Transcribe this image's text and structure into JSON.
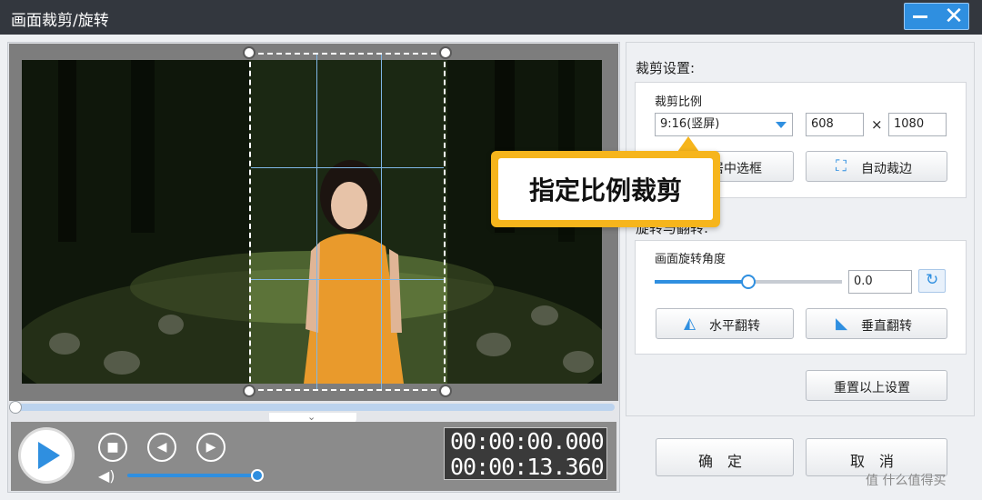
{
  "window": {
    "title": "画面裁剪/旋转",
    "minimize_symbol": "",
    "close_symbol": "✕"
  },
  "crop_settings": {
    "section_title": "裁剪设置:",
    "ratio_label": "裁剪比例",
    "ratio_value": "9:16(竖屏)",
    "width": "608",
    "height": "1080",
    "times_symbol": "×",
    "center_button": "居中选框",
    "auto_crop_button": "自动裁边"
  },
  "rotate_settings": {
    "section_title": "旋转与翻转:",
    "angle_label": "画面旋转角度",
    "angle_value": "0.0",
    "angle_slider_fraction": 0.5,
    "flip_horizontal_button": "水平翻转",
    "flip_vertical_button": "垂直翻转"
  },
  "reset_button": "重置以上设置",
  "ok_button": "确　定",
  "cancel_button": "取　消",
  "playback": {
    "current_time": "00:00:00.000",
    "total_time": "00:00:13.360",
    "progress_fraction": 0.0,
    "volume_fraction": 1.0
  },
  "callout": {
    "text": "指定比例裁剪"
  },
  "watermark": "值 什么值得买",
  "colors": {
    "accent": "#2f8fe0",
    "callout": "#f6b51c",
    "titlebar": "#33373e"
  },
  "icons": {
    "play": "play-icon",
    "stop": "stop-icon",
    "prev": "prev-frame-icon",
    "next": "next-frame-icon",
    "volume": "speaker-icon",
    "auto_crop": "crop-icon",
    "flip_h": "flip-horizontal-icon",
    "flip_v": "flip-vertical-icon",
    "rotate": "rotate-icon"
  }
}
